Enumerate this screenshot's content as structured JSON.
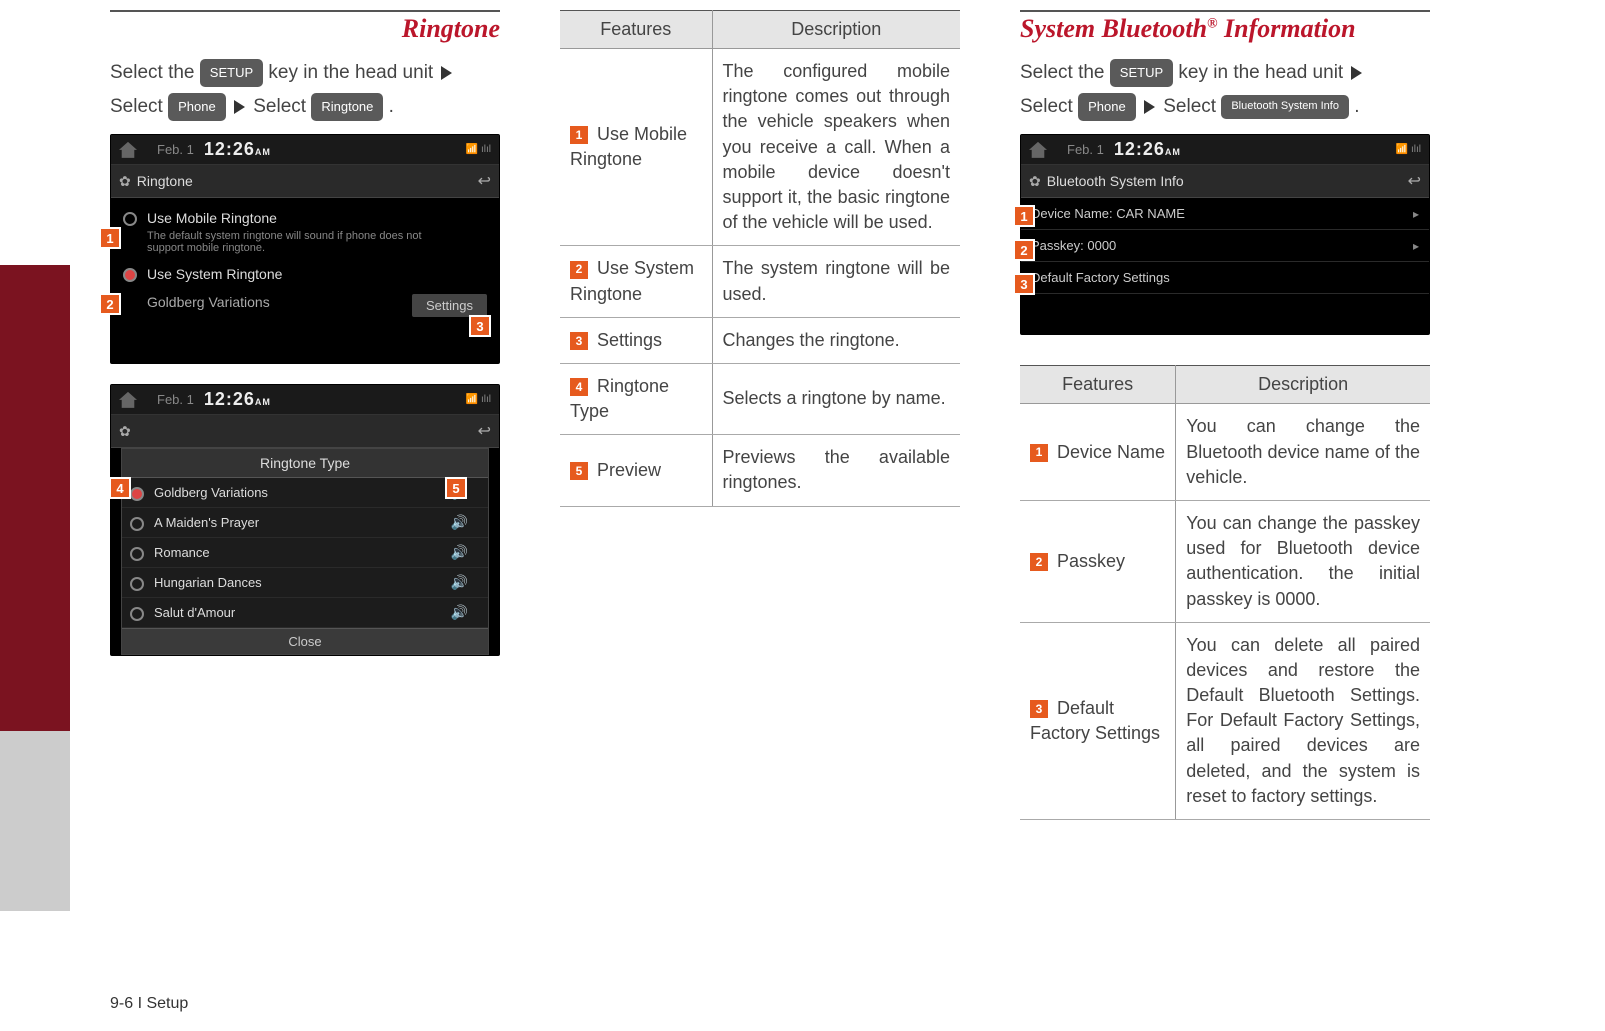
{
  "footer": "9-6 I Setup",
  "col1": {
    "title": "Ringtone",
    "instr_parts": {
      "p1": "Select the ",
      "btn_setup": "SETUP",
      "p2": " key in the head unit ",
      "p3": " Select ",
      "btn_phone": "Phone",
      "p4": " Select ",
      "btn_ringtone": "Ringtone",
      "p5": " ."
    },
    "shot1": {
      "date": "Feb. 1",
      "time": "12:26",
      "ampm": "AM",
      "title": "Ringtone",
      "opt1": "Use Mobile Ringtone",
      "opt1_note": "The default system ringtone will sound if phone does not support mobile ringtone.",
      "opt2": "Use System Ringtone",
      "opt2_sub": "Goldberg Variations",
      "settings_btn": "Settings",
      "callouts": {
        "c1": "1",
        "c2": "2",
        "c3": "3"
      }
    },
    "shot2": {
      "date": "Feb. 1",
      "time": "12:26",
      "ampm": "AM",
      "popup_title": "Ringtone Type",
      "items": [
        "Goldberg Variations",
        "A Maiden's Prayer",
        "Romance",
        "Hungarian Dances",
        "Salut d'Amour"
      ],
      "close": "Close",
      "callouts": {
        "c4": "4",
        "c5": "5"
      }
    }
  },
  "col2": {
    "table_header": {
      "features": "Features",
      "desc": "Description"
    },
    "rows": [
      {
        "num": "1",
        "feat": "Use Mobile Ringtone",
        "desc": "The configured mobile ringtone comes out through the vehicle speakers when you receive a call. When a mobile device doesn't support it, the basic ringtone of the vehicle will be used."
      },
      {
        "num": "2",
        "feat": "Use System Ringtone",
        "desc": "The system ringtone will be used."
      },
      {
        "num": "3",
        "feat": "Settings",
        "desc": "Changes the ringtone."
      },
      {
        "num": "4",
        "feat": "Ringtone Type",
        "desc": "Selects a ringtone by name."
      },
      {
        "num": "5",
        "feat": "Preview",
        "desc": "Previews the available ringtones."
      }
    ]
  },
  "col3": {
    "title_pre": "System Bluetooth",
    "title_sup": "®",
    "title_post": " Information",
    "instr_parts": {
      "p1": "Select the ",
      "btn_setup": "SETUP",
      "p2": " key in the head unit ",
      "p3": " Select ",
      "btn_phone": "Phone",
      "p4": " Select ",
      "btn_info": "Bluetooth System Info",
      "p5": " ."
    },
    "shot": {
      "date": "Feb. 1",
      "time": "12:26",
      "ampm": "AM",
      "title": "Bluetooth System Info",
      "row1": "Device Name: CAR NAME",
      "row2": "Passkey: 0000",
      "row3": "Default Factory Settings",
      "callouts": {
        "c1": "1",
        "c2": "2",
        "c3": "3"
      }
    },
    "table_header": {
      "features": "Features",
      "desc": "Description"
    },
    "rows": [
      {
        "num": "1",
        "feat": "Device Name",
        "desc": "You can change the Bluetooth device name of the vehicle."
      },
      {
        "num": "2",
        "feat": "Passkey",
        "desc": "You can change the passkey used for Bluetooth device authentication. the initial passkey is 0000."
      },
      {
        "num": "3",
        "feat": "Default Factory Settings",
        "desc": "You can delete all paired devices and restore the Default Bluetooth Settings. For Default Factory Settings, all paired devices are deleted, and the system is reset to factory settings."
      }
    ]
  }
}
